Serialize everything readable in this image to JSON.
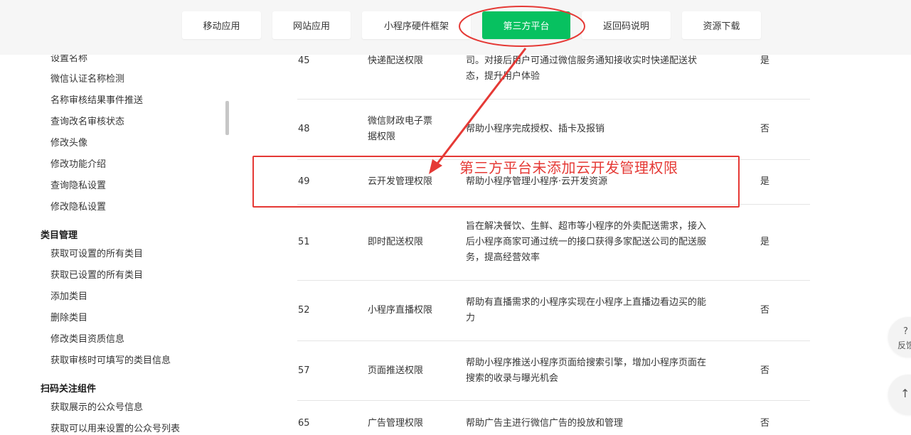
{
  "nav": {
    "items": [
      {
        "label": "移动应用"
      },
      {
        "label": "网站应用"
      },
      {
        "label": "小程序硬件框架"
      },
      {
        "label": "第三方平台"
      },
      {
        "label": "返回码说明"
      },
      {
        "label": "资源下载"
      }
    ],
    "active_index": 3
  },
  "sidebar": {
    "items_a": [
      "设置名称",
      "微信认证名称检测",
      "名称审核结果事件推送",
      "查询改名审核状态",
      "修改头像",
      "修改功能介绍",
      "查询隐私设置",
      "修改隐私设置"
    ],
    "section_category": "类目管理",
    "items_b": [
      "获取可设置的所有类目",
      "获取已设置的所有类目",
      "添加类目",
      "删除类目",
      "修改类目资质信息",
      "获取审核时可填写的类目信息"
    ],
    "section_scan": "扫码关注组件",
    "items_c": [
      "获取展示的公众号信息",
      "获取可以用来设置的公众号列表"
    ]
  },
  "table": {
    "rows": [
      {
        "id": "45",
        "name": "快递配送权限",
        "desc_lines": [
          "司。对接后用户可通过微信服务通知接收实时快递配送状",
          "态，提升用户体验"
        ],
        "flag": "是"
      },
      {
        "id": "48",
        "name_lines": [
          "微信财政电子票",
          "据权限"
        ],
        "desc_lines": [
          "帮助小程序完成授权、插卡及报销"
        ],
        "flag": "否"
      },
      {
        "id": "49",
        "name": "云开发管理权限",
        "desc_lines": [
          "帮助小程序管理小程序·云开发资源"
        ],
        "flag": "是"
      },
      {
        "id": "51",
        "name": "即时配送权限",
        "desc_lines": [
          "旨在解决餐饮、生鲜、超市等小程序的外卖配送需求，接入",
          "后小程序商家可通过统一的接口获得多家配送公司的配送服",
          "务，提高经营效率"
        ],
        "flag": "是"
      },
      {
        "id": "52",
        "name": "小程序直播权限",
        "desc_lines": [
          "帮助有直播需求的小程序实现在小程序上直播边看边买的能",
          "力"
        ],
        "flag": "否"
      },
      {
        "id": "57",
        "name": "页面推送权限",
        "desc_lines": [
          "帮助小程序推送小程序页面给搜索引擎，增加小程序页面在",
          "搜索的收录与曝光机会"
        ],
        "flag": "否"
      },
      {
        "id": "65",
        "name": "广告管理权限",
        "desc_lines": [
          "帮助广告主进行微信广告的投放和管理"
        ],
        "flag": "否"
      }
    ]
  },
  "annotation": {
    "text": "第三方平台未添加云开发管理权限",
    "color": "#e53935"
  },
  "floating": {
    "feedback_q": "?",
    "feedback_label": "反馈",
    "top_arrow": "↑"
  },
  "colors": {
    "accent": "#07c160",
    "annotation": "#e53935",
    "nav_bg": "#f6f6f6"
  }
}
